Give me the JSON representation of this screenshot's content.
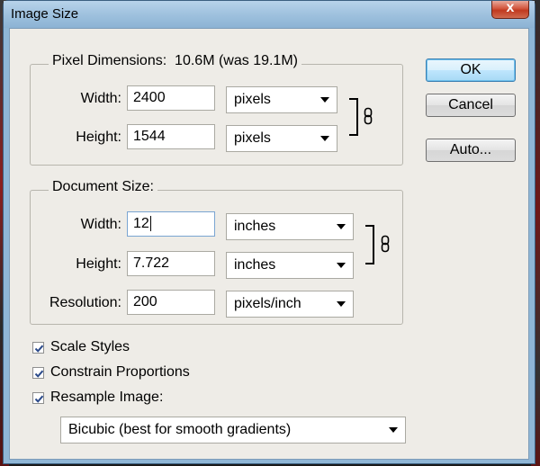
{
  "window": {
    "title": "Image Size",
    "close_symbol": "x"
  },
  "pixel_dimensions": {
    "legend": "Pixel Dimensions:",
    "size_text": "10.6M (was 19.1M)",
    "width_label": "Width:",
    "width_value": "2400",
    "width_unit": "pixels",
    "height_label": "Height:",
    "height_value": "1544",
    "height_unit": "pixels",
    "link_icon": "chain-link-icon"
  },
  "document_size": {
    "legend": "Document Size:",
    "width_label": "Width:",
    "width_value": "12",
    "width_unit": "inches",
    "height_label": "Height:",
    "height_value": "7.722",
    "height_unit": "inches",
    "resolution_label": "Resolution:",
    "resolution_value": "200",
    "resolution_unit": "pixels/inch",
    "link_icon": "chain-link-icon"
  },
  "options": {
    "scale_styles": {
      "label": "Scale Styles",
      "checked": true
    },
    "constrain_proportions": {
      "label": "Constrain Proportions",
      "checked": true
    },
    "resample_image": {
      "label": "Resample Image:",
      "checked": true
    },
    "resample_method": "Bicubic (best for smooth gradients)"
  },
  "buttons": {
    "ok": "OK",
    "cancel": "Cancel",
    "auto": "Auto..."
  },
  "colors": {
    "dialog_bg": "#eeece7",
    "title_bar": "#9fc1de",
    "close_button": "#c0391f",
    "default_button_border": "#3c7fb1"
  }
}
